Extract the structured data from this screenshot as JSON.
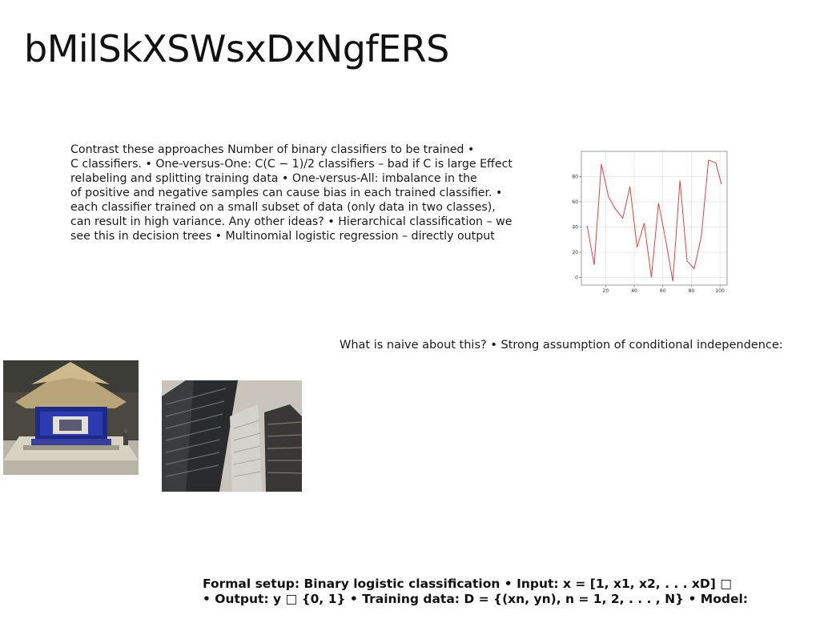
{
  "slide": {
    "title": "bMilSkXSWsxDxNgfERS",
    "body_lines": [
      "Contrast these approaches Number of binary classifiers to be trained •",
      "C classifiers. • One-versus-One: C(C − 1)/2 classifiers – bad if C is large Effect",
      "relabeling and splitting training data • One-versus-All: imbalance in the",
      "of positive and negative samples can cause bias in each trained classifier. •",
      "each classifier trained on a small subset of data (only data in two classes),",
      "can result in high variance. Any other ideas? • Hierarchical classification – we",
      "see this in decision trees • Multinomial logistic regression – directly output"
    ],
    "question": "What is naive about this? • Strong assumption of conditional independence:",
    "formal_lines": [
      "Formal setup: Binary logistic classification • Input: x = [1, x1, x2, . . . xD] □",
      "• Output: y □ {0, 1} • Training data: D = {(xn, yn), n = 1, 2, . . . , N} • Model:"
    ]
  },
  "images": {
    "temple": "temple-photo",
    "towers": "towers-photo"
  },
  "chart_data": {
    "type": "line",
    "x": [
      7,
      12,
      17,
      22,
      27,
      32,
      37,
      42,
      47,
      52,
      57,
      62,
      67,
      72,
      77,
      82,
      87,
      92,
      97,
      101
    ],
    "series": [
      {
        "values": [
          41,
          10,
          90,
          64,
          54,
          47,
          72,
          24,
          43,
          0,
          59,
          30,
          -3,
          77,
          13,
          7,
          33,
          93,
          91,
          74
        ]
      }
    ],
    "xticks": [
      20,
      40,
      60,
      80,
      100
    ],
    "yticks": [
      0,
      20,
      40,
      60,
      80
    ],
    "xlim": [
      3,
      105
    ],
    "ylim": [
      -6,
      100
    ],
    "grid": true,
    "line_color": "#e8413a"
  }
}
